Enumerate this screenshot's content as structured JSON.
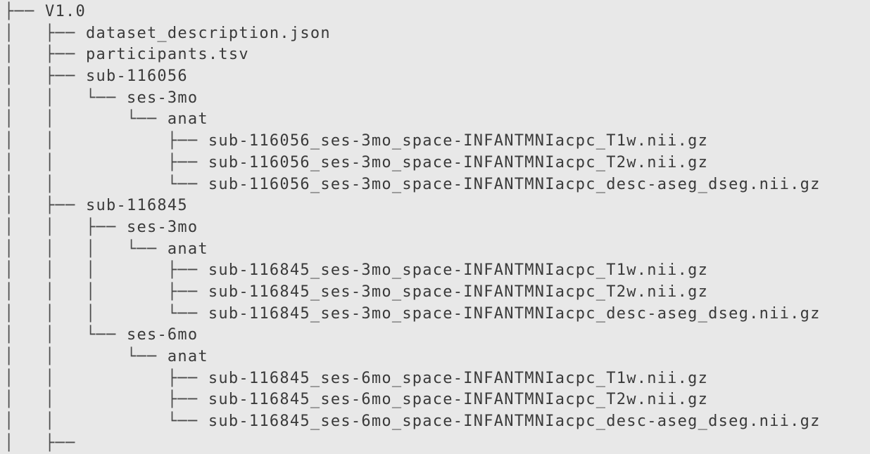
{
  "tree": [
    {
      "prefix": "├── ",
      "name": "V1.0"
    },
    {
      "prefix": "│   ├── ",
      "name": "dataset_description.json"
    },
    {
      "prefix": "│   ├── ",
      "name": "participants.tsv"
    },
    {
      "prefix": "│   ├── ",
      "name": "sub-116056"
    },
    {
      "prefix": "│   │   └── ",
      "name": "ses-3mo"
    },
    {
      "prefix": "│   │       └── ",
      "name": "anat"
    },
    {
      "prefix": "│   │           ├── ",
      "name": "sub-116056_ses-3mo_space-INFANTMNIacpc_T1w.nii.gz"
    },
    {
      "prefix": "│   │           ├── ",
      "name": "sub-116056_ses-3mo_space-INFANTMNIacpc_T2w.nii.gz"
    },
    {
      "prefix": "│   │           └── ",
      "name": "sub-116056_ses-3mo_space-INFANTMNIacpc_desc-aseg_dseg.nii.gz"
    },
    {
      "prefix": "│   ├── ",
      "name": "sub-116845"
    },
    {
      "prefix": "│   │   ├── ",
      "name": "ses-3mo"
    },
    {
      "prefix": "│   │   │   └── ",
      "name": "anat"
    },
    {
      "prefix": "│   │   │       ├── ",
      "name": "sub-116845_ses-3mo_space-INFANTMNIacpc_T1w.nii.gz"
    },
    {
      "prefix": "│   │   │       ├── ",
      "name": "sub-116845_ses-3mo_space-INFANTMNIacpc_T2w.nii.gz"
    },
    {
      "prefix": "│   │   │       └── ",
      "name": "sub-116845_ses-3mo_space-INFANTMNIacpc_desc-aseg_dseg.nii.gz"
    },
    {
      "prefix": "│   │   └── ",
      "name": "ses-6mo"
    },
    {
      "prefix": "│   │       └── ",
      "name": "anat"
    },
    {
      "prefix": "│   │           ├── ",
      "name": "sub-116845_ses-6mo_space-INFANTMNIacpc_T1w.nii.gz"
    },
    {
      "prefix": "│   │           ├── ",
      "name": "sub-116845_ses-6mo_space-INFANTMNIacpc_T2w.nii.gz"
    },
    {
      "prefix": "│   │           └── ",
      "name": "sub-116845_ses-6mo_space-INFANTMNIacpc_desc-aseg_dseg.nii.gz"
    },
    {
      "prefix": "│   ├── ",
      "name": ""
    }
  ]
}
